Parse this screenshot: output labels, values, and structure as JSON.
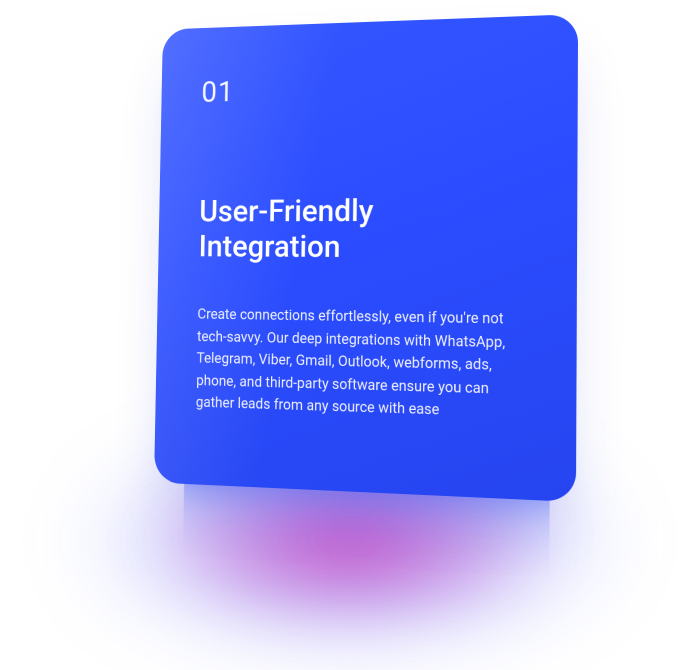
{
  "card": {
    "number": "01",
    "title": "User-Friendly Integration",
    "body": "Create connections effortlessly, even if you're not tech-savvy. Our deep integrations with WhatsApp, Telegram, Viber, Gmail, Outlook, webforms, ads, phone, and third-party software ensure you can gather leads from any source with ease"
  },
  "colors": {
    "card_bg": "#2b4dff",
    "glow_pink": "#d62bb3",
    "glow_blue": "#485eff"
  }
}
